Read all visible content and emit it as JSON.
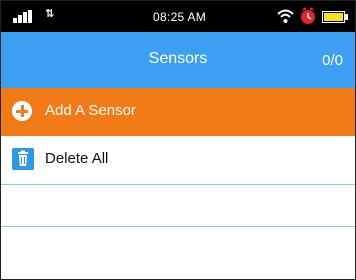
{
  "status_bar": {
    "time": "08:25 AM",
    "icons": [
      "signal-icon",
      "data-transfer-icon",
      "wifi-icon",
      "alarm-icon",
      "battery-icon"
    ]
  },
  "header": {
    "title": "Sensors",
    "count": "0/0"
  },
  "list": {
    "add_label": "Add A Sensor",
    "delete_label": "Delete All"
  },
  "colors": {
    "header": "#3c9ff2",
    "accent": "#f27a17",
    "divider": "#8ec9f2",
    "trash_icon": "#2f97e3"
  }
}
